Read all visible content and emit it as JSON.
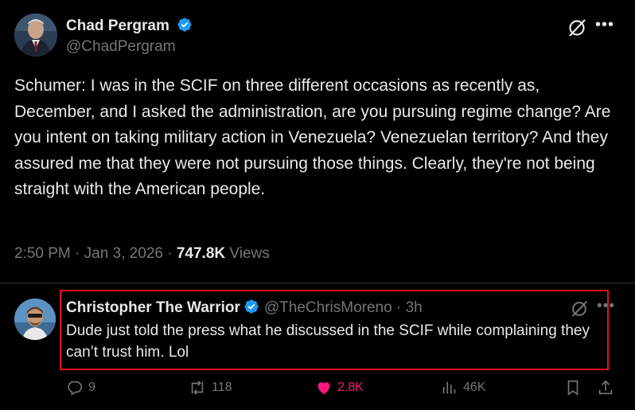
{
  "main_tweet": {
    "author_name": "Chad Pergram",
    "author_handle": "@ChadPergram",
    "text": "Schumer: I was in the SCIF on three different occasions as recently as, December, and I asked the administration, are you pursuing regime change? Are you intent on taking military action in Venezuela? Venezuelan territory? And they assured me that they were not pursuing those things. Clearly, they're not being straight with the American people.",
    "timestamp": "2:50 PM · Jan 3, 2026 · ",
    "views_count": "747.8K",
    "views_label": " Views"
  },
  "reply": {
    "author_name": "Christopher The Warrior",
    "author_handle": "@TheChrisMoreno",
    "separator": " · ",
    "time_ago": "3h",
    "text": "Dude just told the press what he discussed in the SCIF while complaining they can’t trust him. Lol",
    "actions": {
      "replies": "9",
      "reposts": "118",
      "likes": "2.8K",
      "views": "46K"
    }
  },
  "icons": {
    "verified": "verified-badge-icon",
    "grok": "grok-icon",
    "more": "more-icon",
    "reply": "reply-icon",
    "repost": "repost-icon",
    "like": "heart-icon",
    "views": "views-chart-icon",
    "bookmark": "bookmark-icon",
    "share": "share-icon"
  },
  "colors": {
    "background": "#000000",
    "text": "#e7e9ea",
    "muted": "#71767b",
    "verified": "#1d9bf0",
    "like": "#f91880",
    "highlight": "#e0111b"
  }
}
